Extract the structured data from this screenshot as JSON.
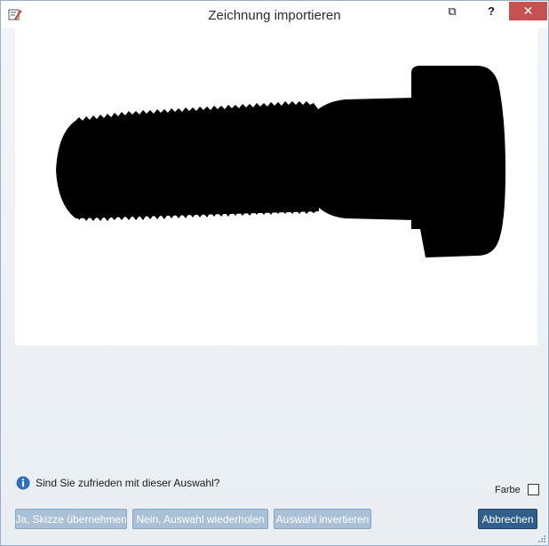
{
  "window": {
    "title": "Zeichnung importieren",
    "close_glyph": "✕",
    "help_glyph": "?",
    "restore_glyph": "⧉"
  },
  "icons": {
    "app": "edit-drawing-icon",
    "info": "info-icon",
    "grip": "resize-grip-icon"
  },
  "dialog": {
    "question": "Sind Sie zufrieden mit dieser Auswahl?",
    "farbe_label": "Farbe",
    "farbe_checked": false
  },
  "buttons": {
    "accept": "Ja, Skizze übernehmen",
    "retry": "Nein, Auswahl wiederholen",
    "invert": "Auswahl invertieren",
    "cancel": "Abbrechen"
  },
  "colors": {
    "close_button": "#c75050",
    "primary_button": "#2f5f8a",
    "disabled_button": "#a9c0d6",
    "info_icon": "#2f6fbf"
  }
}
